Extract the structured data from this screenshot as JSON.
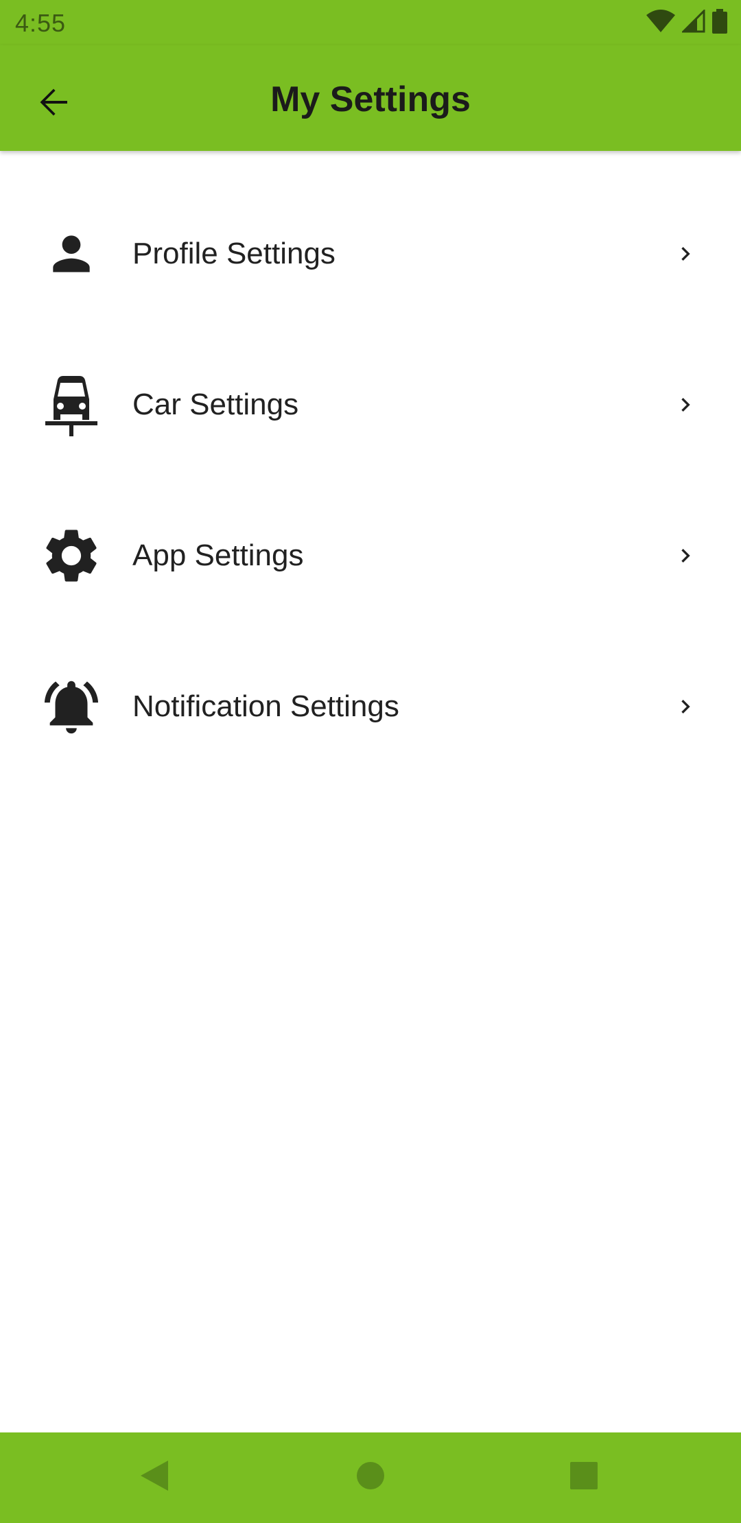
{
  "status_bar": {
    "time": "4:55",
    "icons": [
      "wifi-icon",
      "signal-icon",
      "battery-icon"
    ]
  },
  "app_bar": {
    "title": "My Settings",
    "back_icon": "arrow-back-icon"
  },
  "settings": {
    "items": [
      {
        "label": "Profile Settings",
        "icon": "person-icon"
      },
      {
        "label": "Car Settings",
        "icon": "car-icon"
      },
      {
        "label": "App Settings",
        "icon": "gear-icon"
      },
      {
        "label": "Notification Settings",
        "icon": "bell-ringing-icon"
      }
    ]
  },
  "nav_bar": {
    "buttons": [
      "back-triangle-icon",
      "home-circle-icon",
      "recents-square-icon"
    ]
  },
  "colors": {
    "accent": "#7abe22",
    "text": "#212121",
    "nav_icon": "#5a8f1a"
  }
}
